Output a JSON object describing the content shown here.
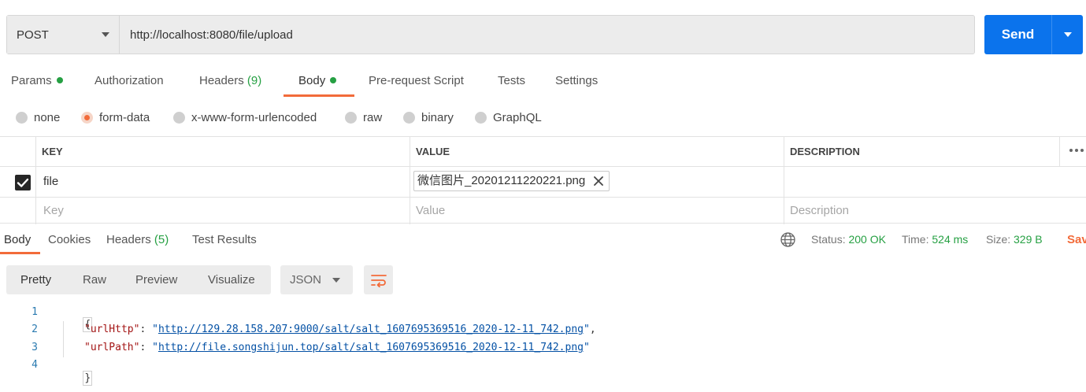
{
  "request": {
    "method": "POST",
    "url": "http://localhost:8080/file/upload",
    "send_label": "Send"
  },
  "request_tabs": [
    {
      "label": "Params",
      "dot": true
    },
    {
      "label": "Authorization"
    },
    {
      "label": "Headers",
      "count": "(9)"
    },
    {
      "label": "Body",
      "dot": true,
      "active": true
    },
    {
      "label": "Pre-request Script"
    },
    {
      "label": "Tests"
    },
    {
      "label": "Settings"
    }
  ],
  "body_types": [
    {
      "label": "none"
    },
    {
      "label": "form-data",
      "selected": true
    },
    {
      "label": "x-www-form-urlencoded"
    },
    {
      "label": "raw"
    },
    {
      "label": "binary"
    },
    {
      "label": "GraphQL"
    }
  ],
  "params_table": {
    "headers": {
      "key": "KEY",
      "value": "VALUE",
      "description": "DESCRIPTION"
    },
    "rows": [
      {
        "checked": true,
        "key": "file",
        "value_file": "微信图片_20201211220221.png",
        "description": ""
      }
    ],
    "placeholders": {
      "key": "Key",
      "value": "Value",
      "description": "Description"
    }
  },
  "response_tabs": [
    {
      "label": "Body",
      "active": true
    },
    {
      "label": "Cookies"
    },
    {
      "label": "Headers",
      "count": "(5)"
    },
    {
      "label": "Test Results"
    }
  ],
  "response_status": {
    "status_label": "Status:",
    "status_value": "200 OK",
    "time_label": "Time:",
    "time_value": "524 ms",
    "size_label": "Size:",
    "size_value": "329 B",
    "save_label": "Save Response"
  },
  "view_modes": [
    {
      "label": "Pretty",
      "active": true
    },
    {
      "label": "Raw"
    },
    {
      "label": "Preview"
    },
    {
      "label": "Visualize"
    }
  ],
  "format": "JSON",
  "code": {
    "line_numbers": [
      "1",
      "2",
      "3",
      "4"
    ],
    "open_brace": "{",
    "close_brace": "}",
    "entries": [
      {
        "key": "\"urlHttp\"",
        "colon": ": ",
        "quote_open": "\"",
        "url": "http://129.28.158.207:9000/salt/salt_1607695369516_2020-12-11_742.png",
        "quote_close": "\"",
        "comma": ","
      },
      {
        "key": "\"urlPath\"",
        "colon": ": ",
        "quote_open": "\"",
        "url": "http://file.songshijun.top/salt/salt_1607695369516_2020-12-11_742.png",
        "quote_close": "\"",
        "comma": ""
      }
    ]
  },
  "colors": {
    "accent": "#f26b3a",
    "send": "#0b73ec",
    "success": "#26a043"
  },
  "icons": [
    "chevron-down-icon",
    "checkbox-checked-icon",
    "close-icon",
    "more-dots-icon",
    "globe-icon",
    "wrap-lines-icon"
  ]
}
